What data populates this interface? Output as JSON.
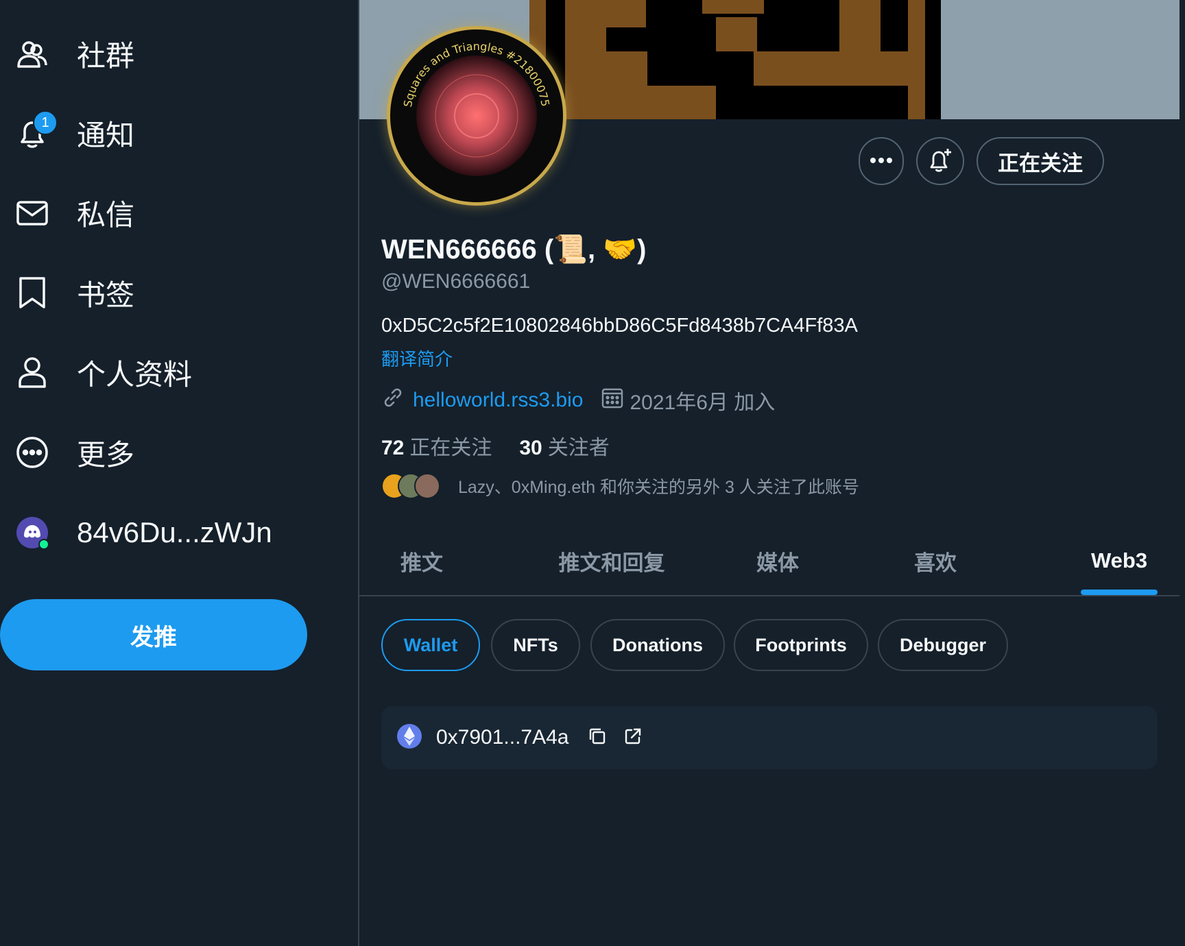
{
  "sidebar": {
    "items": [
      {
        "label": "社群",
        "icon": "communities-icon"
      },
      {
        "label": "通知",
        "icon": "bell-icon",
        "badge": "1"
      },
      {
        "label": "私信",
        "icon": "mail-icon"
      },
      {
        "label": "书签",
        "icon": "bookmark-icon"
      },
      {
        "label": "个人资料",
        "icon": "person-icon"
      },
      {
        "label": "更多",
        "icon": "more-circle-icon"
      },
      {
        "label": "84v6Du...zWJn",
        "icon": "ghost-wallet-icon"
      }
    ],
    "tweet_button": "发推"
  },
  "profile": {
    "avatar_text": "Squares and Triangles #21800075",
    "follow_button": "正在关注",
    "display_name": "WEN666666 (📜, 🤝)",
    "handle": "@WEN6666661",
    "bio": "0xD5C2c5f2E10802846bbD86C5Fd8438b7CA4Ff83A",
    "translate": "翻译简介",
    "website": "helloworld.rss3.bio",
    "joined": "2021年6月 加入",
    "following_count": "72",
    "following_label": "正在关注",
    "followers_count": "30",
    "followers_label": "关注者",
    "followed_by": "Lazy、0xMing.eth 和你关注的另外 3 人关注了此账号"
  },
  "tabs": [
    {
      "label": "推文"
    },
    {
      "label": "推文和回复"
    },
    {
      "label": "媒体"
    },
    {
      "label": "喜欢"
    },
    {
      "label": "Web3",
      "active": true
    }
  ],
  "web3": {
    "chips": [
      "Wallet",
      "NFTs",
      "Donations",
      "Footprints",
      "Debugger"
    ],
    "active_chip": "Wallet",
    "wallet_address": "0x7901...7A4a"
  },
  "colors": {
    "background": "#15202b",
    "accent": "#1d9bf0",
    "muted_text": "#8b98a5",
    "border": "#38444d"
  }
}
